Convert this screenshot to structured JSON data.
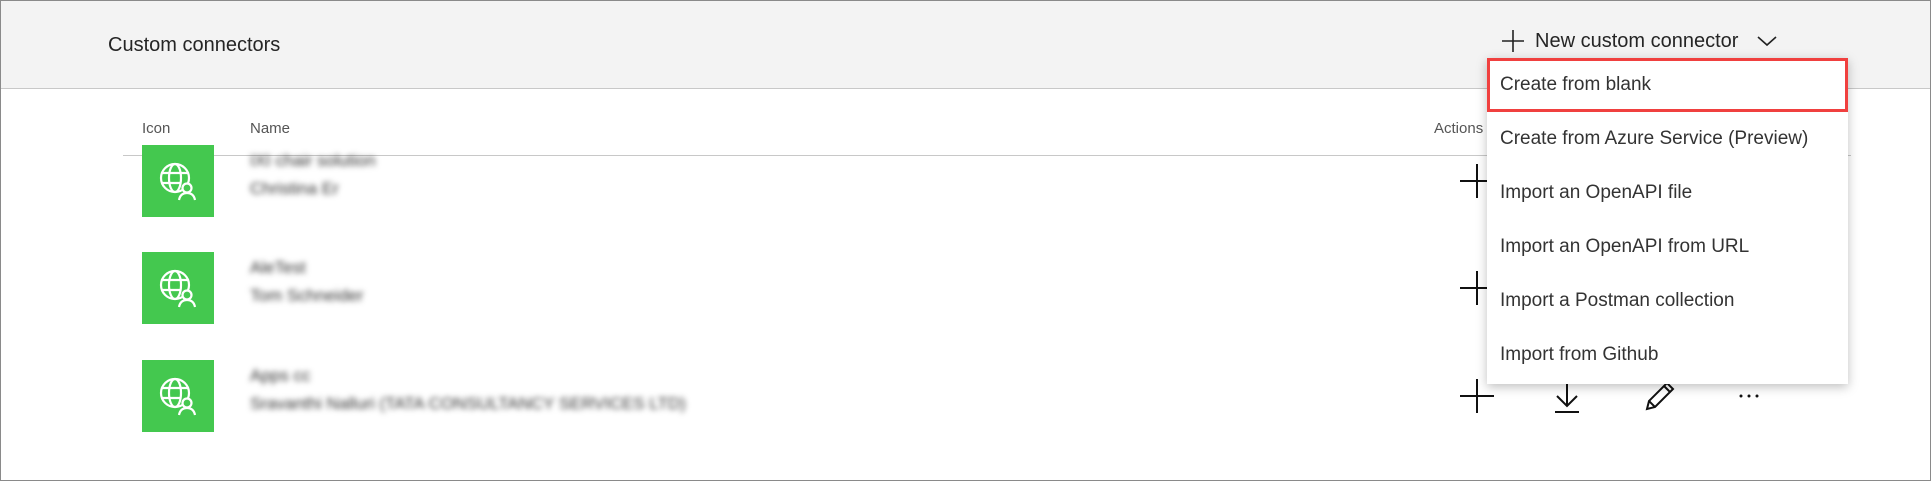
{
  "header": {
    "title": "Custom connectors",
    "new_button": "New custom connector"
  },
  "columns": {
    "icon": "Icon",
    "name": "Name",
    "actions": "Actions"
  },
  "rows": [
    {
      "name": "IXI chair solution",
      "owner": "Christina Er"
    },
    {
      "name": "AleTest",
      "owner": "Tom Schneider"
    },
    {
      "name": "Apps cc",
      "owner": "Sravanthi Nalluri (TATA CONSULTANCY SERVICES LTD)"
    }
  ],
  "menu": {
    "items": [
      {
        "label": "Create from blank",
        "highlighted": true
      },
      {
        "label": "Create from Azure Service (Preview)"
      },
      {
        "label": "Import an OpenAPI file"
      },
      {
        "label": "Import an OpenAPI from URL"
      },
      {
        "label": "Import a Postman collection"
      },
      {
        "label": "Import from Github"
      }
    ]
  },
  "colors": {
    "icon_bg": "#44c84f",
    "highlight": "#f0403f",
    "header_bg": "#f3f3f3"
  }
}
